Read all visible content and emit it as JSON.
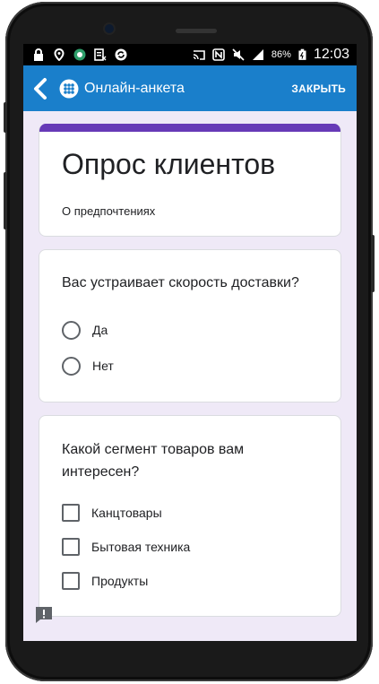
{
  "status_bar": {
    "battery": "86%",
    "time": "12:03"
  },
  "app_bar": {
    "title": "Онлайн-анкета",
    "close_label": "ЗАКРЫТЬ"
  },
  "form": {
    "title": "Опрос клиентов",
    "description": "О предпочтениях"
  },
  "questions": [
    {
      "title": "Вас устраивает скорость доставки?",
      "type": "radio",
      "options": [
        "Да",
        "Нет"
      ]
    },
    {
      "title": "Какой сегмент товаров вам интересен?",
      "type": "checkbox",
      "options": [
        "Канцтовары",
        "Бытовая техника",
        "Продукты"
      ]
    }
  ],
  "colors": {
    "app_bar": "#1a7fcb",
    "form_accent": "#673ab7",
    "background": "#efe9f7"
  },
  "icons": [
    "lock-icon",
    "location-icon",
    "vpn-icon",
    "data-icon",
    "sync-icon",
    "cast-icon",
    "nfc-icon",
    "mute-icon",
    "signal-icon",
    "battery-icon",
    "back-arrow-icon",
    "app-logo-icon",
    "report-icon"
  ]
}
